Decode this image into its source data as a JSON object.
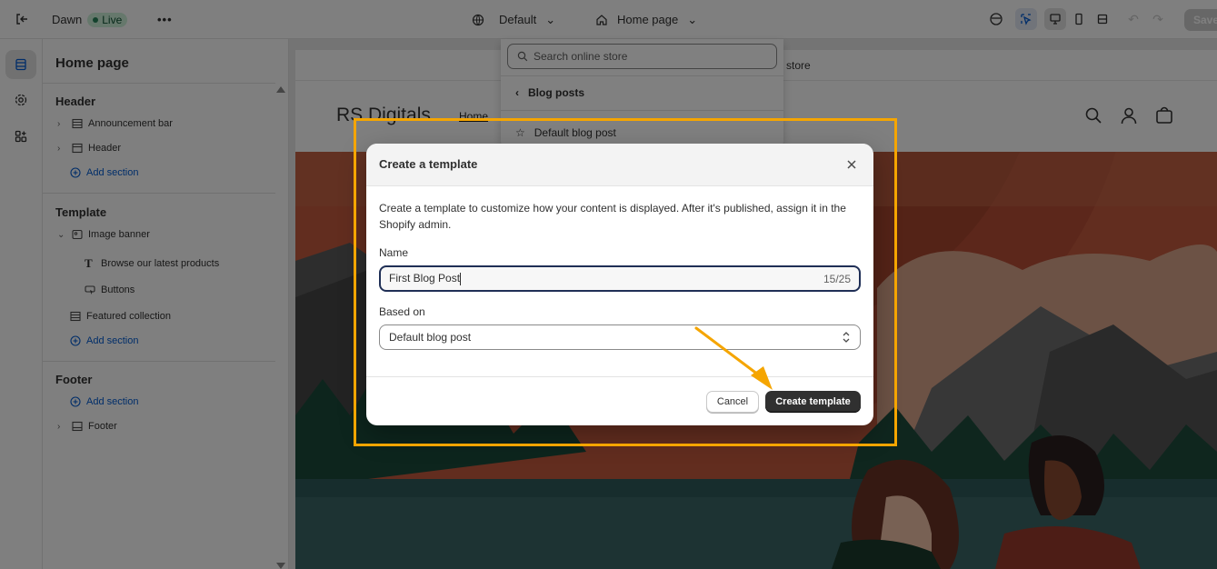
{
  "topbar": {
    "theme_name": "Dawn",
    "live_label": "Live",
    "more_label": "•••",
    "theme_selector": "Default",
    "page_selector": "Home page",
    "save_label": "Save"
  },
  "sidebar": {
    "title": "Home page",
    "header_group": "Header",
    "header_items": [
      "Announcement bar",
      "Header"
    ],
    "add_section_label": "Add section",
    "template_group": "Template",
    "image_banner": "Image banner",
    "image_banner_blocks": [
      "Browse our latest products",
      "Buttons"
    ],
    "featured_collection": "Featured collection",
    "footer_group": "Footer",
    "footer_item": "Footer"
  },
  "preview": {
    "announcement": "store",
    "brand": "RS Digitals",
    "nav_home": "Home"
  },
  "dropdown": {
    "search_placeholder": "Search online store",
    "back_label": "Blog posts",
    "item": "Default blog post"
  },
  "modal": {
    "title": "Create a template",
    "description": "Create a template to customize how your content is displayed. After it's published, assign it in the Shopify admin.",
    "name_label": "Name",
    "name_value": "First Blog Post",
    "name_count": "15/25",
    "based_on_label": "Based on",
    "based_on_value": "Default blog post",
    "cancel_label": "Cancel",
    "create_label": "Create template"
  },
  "colors": {
    "accent_highlight": "#f5a500",
    "primary_button": "#303030",
    "live_badge": "#cdf0d9",
    "link_blue": "#005bd3"
  }
}
